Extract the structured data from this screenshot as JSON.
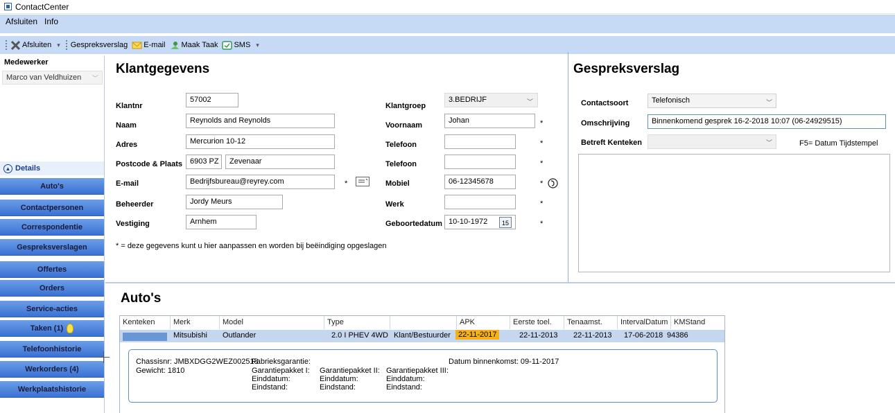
{
  "window": {
    "title": "ContactCenter"
  },
  "menu": {
    "items": [
      "Afsluiten",
      "Info"
    ]
  },
  "toolbar": {
    "afsluiten": "Afsluiten",
    "gespreksverslag": "Gespreksverslag",
    "email": "E-mail",
    "maak_taak": "Maak Taak",
    "sms": "SMS"
  },
  "sidebar": {
    "medewerker_label": "Medewerker",
    "medewerker_value": "Marco van Veldhuizen",
    "details_label": "Details",
    "nav": [
      "Auto's",
      "Contactpersonen",
      "Correspondentie",
      "Gespreksverslagen",
      "Offertes",
      "Orders",
      "Service-acties",
      "Taken (1)",
      "Telefoonhistorie",
      "Werkorders (4)",
      "Werkplaatshistorie"
    ]
  },
  "klant": {
    "title": "Klantgegevens",
    "klantnr_label": "Klantnr",
    "klantnr": "57002",
    "naam_label": "Naam",
    "naam": "Reynolds and Reynolds",
    "adres_label": "Adres",
    "adres": "Mercurion 10-12",
    "postcode_label": "Postcode & Plaats",
    "postcode": "6903 PZ",
    "plaats": "Zevenaar",
    "email_label": "E-mail",
    "email": "Bedrijfsbureau@reyrey.com",
    "beheerder_label": "Beheerder",
    "beheerder": "Jordy Meurs",
    "vestiging_label": "Vestiging",
    "vestiging": "Arnhem",
    "klantgroep_label": "Klantgroep",
    "klantgroep": "3.BEDRIJF",
    "voornaam_label": "Voornaam",
    "voornaam": "Johan",
    "telefoon1_label": "Telefoon",
    "telefoon1": "",
    "telefoon2_label": "Telefoon",
    "telefoon2": "",
    "mobiel_label": "Mobiel",
    "mobiel": "06-12345678",
    "werk_label": "Werk",
    "werk": "",
    "geboortedatum_label": "Geboortedatum",
    "geboortedatum": "10-10-1972",
    "calendar_day": "15",
    "star": "*",
    "note": "* = deze gegevens kunt u hier aanpassen en worden bij beëindiging opgeslagen"
  },
  "verslag": {
    "title": "Gespreksverslag",
    "contactsoort_label": "Contactsoort",
    "contactsoort": "Telefonisch",
    "omschrijving_label": "Omschrijving",
    "omschrijving": "Binnenkomend gesprek 16-2-2018 10:07 (06-24929515)",
    "kenteken_label": "Betreft Kenteken",
    "kenteken": "",
    "hint": "F5= Datum Tijdstempel",
    "body": ""
  },
  "autos": {
    "title": "Auto's",
    "columns": [
      "Kenteken",
      "Merk",
      "Model",
      "Type",
      "",
      "APK",
      "Eerste toel.",
      "Tenaamst.",
      "IntervalDatum",
      "KMStand"
    ],
    "row": [
      "",
      "Mitsubishi",
      "Outlander",
      "2.0 I PHEV 4WD",
      "Klant/Bestuurder",
      "22-11-2017",
      "22-11-2013",
      "22-11-2013",
      "17-06-2018",
      "94386"
    ],
    "apk_highlight": "#f6b11a",
    "detail": {
      "chassis": "Chassisnr: JMBXDGG2WEZ002518",
      "gewicht": "Gewicht: 1810",
      "fabrieksgarantie": "Fabrieksgarantie:",
      "pakket1": "Garantiepakket I:",
      "pakket2": "Garantiepakket II:",
      "pakket3": "Garantiepakket III:",
      "einddatum": "Einddatum:",
      "eindstand": "Eindstand:",
      "binnenkomst": "Datum binnenkomst: 09-11-2017"
    }
  }
}
